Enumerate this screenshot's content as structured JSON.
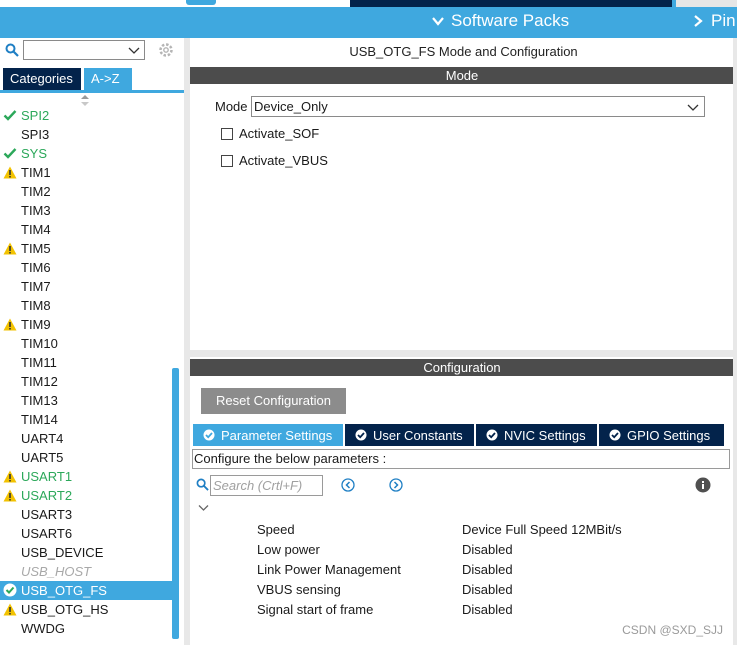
{
  "topbar": {
    "software_packs": "Software Packs",
    "pinout": "Pin"
  },
  "left": {
    "search": {
      "value": "",
      "placeholder": ""
    },
    "tabs": {
      "categories": "Categories",
      "az": "A->Z"
    },
    "items": [
      {
        "label": "SPI2",
        "status": "ok"
      },
      {
        "label": "SPI3",
        "status": "none"
      },
      {
        "label": "SYS",
        "status": "ok"
      },
      {
        "label": "TIM1",
        "status": "warning"
      },
      {
        "label": "TIM2",
        "status": "none"
      },
      {
        "label": "TIM3",
        "status": "none"
      },
      {
        "label": "TIM4",
        "status": "none"
      },
      {
        "label": "TIM5",
        "status": "warning"
      },
      {
        "label": "TIM6",
        "status": "none"
      },
      {
        "label": "TIM7",
        "status": "none"
      },
      {
        "label": "TIM8",
        "status": "none"
      },
      {
        "label": "TIM9",
        "status": "warning"
      },
      {
        "label": "TIM10",
        "status": "none"
      },
      {
        "label": "TIM11",
        "status": "none"
      },
      {
        "label": "TIM12",
        "status": "none"
      },
      {
        "label": "TIM13",
        "status": "none"
      },
      {
        "label": "TIM14",
        "status": "none"
      },
      {
        "label": "UART4",
        "status": "none"
      },
      {
        "label": "UART5",
        "status": "none"
      },
      {
        "label": "USART1",
        "status": "warning-green"
      },
      {
        "label": "USART2",
        "status": "warning-green"
      },
      {
        "label": "USART3",
        "status": "none"
      },
      {
        "label": "USART6",
        "status": "none"
      },
      {
        "label": "USB_DEVICE",
        "status": "none"
      },
      {
        "label": "USB_HOST",
        "status": "disabled"
      },
      {
        "label": "USB_OTG_FS",
        "status": "selected-ok"
      },
      {
        "label": "USB_OTG_HS",
        "status": "warning"
      },
      {
        "label": "WWDG",
        "status": "none"
      }
    ]
  },
  "main": {
    "title": "USB_OTG_FS Mode and Configuration",
    "mode_header": "Mode",
    "mode_label": "Mode",
    "mode_value": "Device_Only",
    "checkboxes": [
      "Activate_SOF",
      "Activate_VBUS"
    ],
    "config_header": "Configuration",
    "reset_button": "Reset Configuration",
    "tabs": [
      "Parameter Settings",
      "User Constants",
      "NVIC Settings",
      "GPIO Settings"
    ],
    "info_text": "Configure the below parameters :",
    "param_search_placeholder": "Search (Crtl+F)",
    "params": [
      {
        "name": "Speed",
        "value": "Device Full Speed 12MBit/s"
      },
      {
        "name": "Low power",
        "value": "Disabled"
      },
      {
        "name": "Link Power Management",
        "value": "Disabled"
      },
      {
        "name": "VBUS sensing",
        "value": "Disabled"
      },
      {
        "name": "Signal start of frame",
        "value": "Disabled"
      }
    ]
  },
  "watermark": "CSDN @SXD_SJJ",
  "colors": {
    "accent": "#3fa8df",
    "navy": "#03234b",
    "ok_green": "#2ca85a",
    "warning_yellow": "#f2c200"
  }
}
